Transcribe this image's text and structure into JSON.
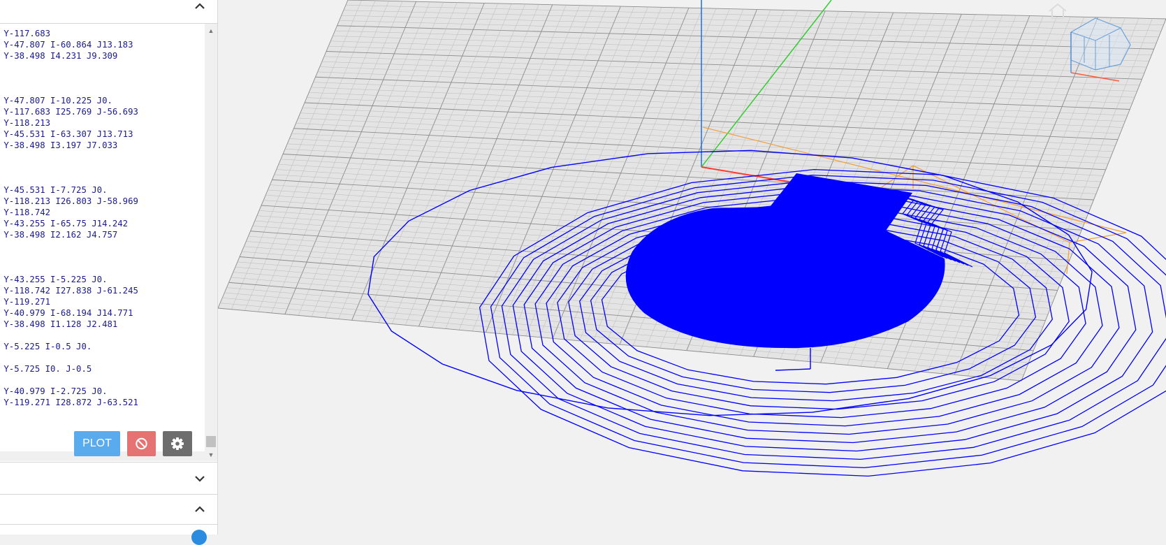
{
  "gcode": {
    "lines": [
      "Y-117.683",
      "Y-47.807 I-60.864 J13.183",
      "Y-38.498 I4.231 J9.309",
      "",
      "",
      "",
      "Y-47.807 I-10.225 J0.",
      "Y-117.683 I25.769 J-56.693",
      "Y-118.213",
      "Y-45.531 I-63.307 J13.713",
      "Y-38.498 I3.197 J7.033",
      "",
      "",
      "",
      "Y-45.531 I-7.725 J0.",
      "Y-118.213 I26.803 J-58.969",
      "Y-118.742",
      "Y-43.255 I-65.75 J14.242",
      "Y-38.498 I2.162 J4.757",
      "",
      "",
      "",
      "Y-43.255 I-5.225 J0.",
      "Y-118.742 I27.838 J-61.245",
      "Y-119.271",
      "Y-40.979 I-68.194 J14.771",
      "Y-38.498 I1.128 J2.481",
      "",
      "Y-5.225 I-0.5 J0.",
      "",
      "Y-5.725 I0. J-0.5",
      "",
      "Y-40.979 I-2.725 J0.",
      "Y-119.271 I28.872 J-63.521"
    ]
  },
  "buttons": {
    "plot_label": "PLOT",
    "cancel_icon": "ban-icon",
    "settings_icon": "gear-icon"
  },
  "panels": {
    "top_chevron": "chevron-up-icon",
    "middle_chevron": "chevron-down-icon",
    "bottom_chevron": "chevron-up-icon"
  },
  "colors": {
    "toolpath": "#0000ff",
    "plot_button": "#5aabee",
    "cancel_button": "#e57373",
    "settings_button": "#6d6d6d",
    "axis_x": "#ff3b30",
    "axis_y": "#33cc33",
    "axis_z": "#1e6fe0",
    "bounding_box": "#f0a040",
    "grid": "#9a9a9a"
  }
}
